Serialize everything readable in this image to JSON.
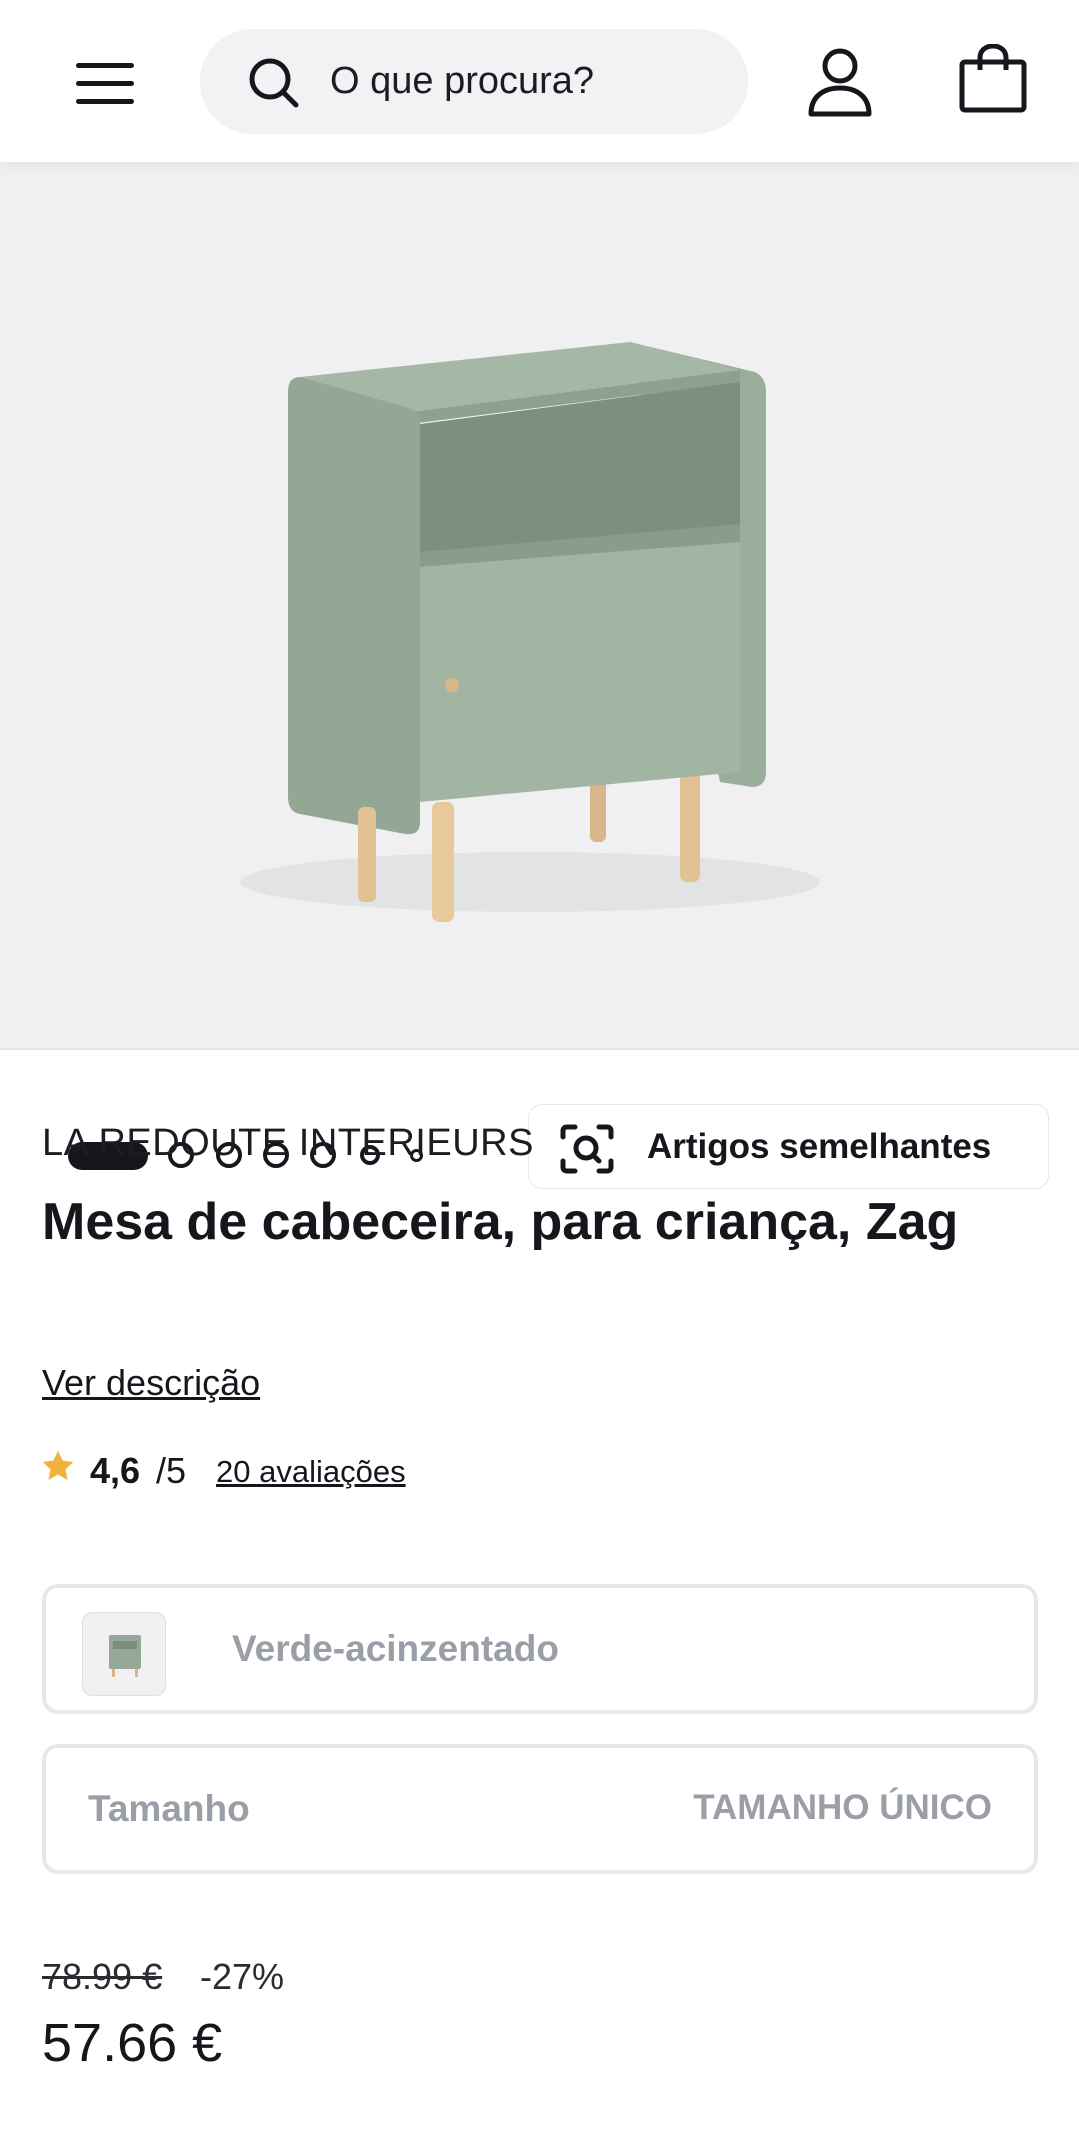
{
  "header": {
    "search_placeholder": "O que procura?",
    "menu_icon": "hamburger-menu-icon",
    "search_icon": "search-icon",
    "account_icon": "user-account-icon",
    "cart_icon": "shopping-bag-icon"
  },
  "gallery": {
    "image_subject": "sage green bedside table with wooden legs",
    "image_count": 7,
    "active_index": 1,
    "similar_button_label": "Artigos semelhantes",
    "similar_icon": "visual-search-icon"
  },
  "product": {
    "brand": "LA REDOUTE INTERIEURS",
    "title": "Mesa de cabeceira, para criança, Zag",
    "description_link": "Ver descrição",
    "rating_value": "4,6",
    "rating_scale": "/5",
    "reviews_link": "20 avaliações",
    "star_color": "#f2b33d"
  },
  "options": {
    "color_value": "Verde-acinzentado",
    "size_label": "Tamanho",
    "size_value": "TAMANHO ÚNICO"
  },
  "pricing": {
    "old_price": "78.99 €",
    "discount": "-27%",
    "price": "57.66 €"
  }
}
